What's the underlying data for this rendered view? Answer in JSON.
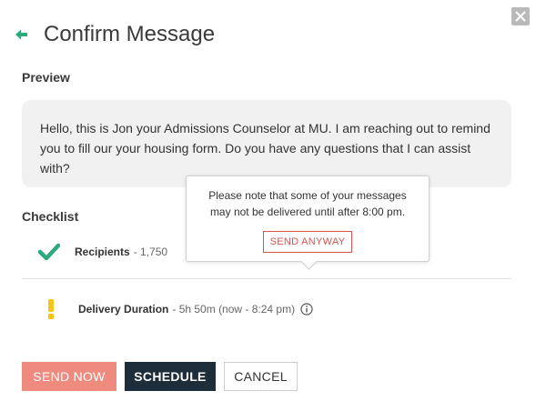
{
  "dialog": {
    "title": "Confirm Message"
  },
  "preview": {
    "label": "Preview",
    "message": "Hello, this is Jon your Admissions Counselor at MU. I am reaching out to remind you to fill our your housing form. Do you have any questions that I can assist with?"
  },
  "checklist": {
    "label": "Checklist",
    "items": [
      {
        "label": "Recipients",
        "value": "- 1,750",
        "status_icon": "check-icon"
      },
      {
        "label": "Delivery Duration",
        "value": "- 5h 50m (now - 8:24 pm)",
        "status_icon": "warning-icon"
      }
    ]
  },
  "tooltip": {
    "text": "Please note that some of your messages may not be delivered until after 8:00 pm.",
    "action_label": "SEND ANYWAY"
  },
  "actions": {
    "send_now": "SEND NOW",
    "schedule": "SCHEDULE",
    "cancel": "CANCEL"
  },
  "colors": {
    "accent_green": "#2bab7c",
    "warning_yellow": "#f5c518",
    "send_now_bg": "#ef8b7e",
    "schedule_bg": "#1e2d3a",
    "danger_red": "#d9534f"
  }
}
